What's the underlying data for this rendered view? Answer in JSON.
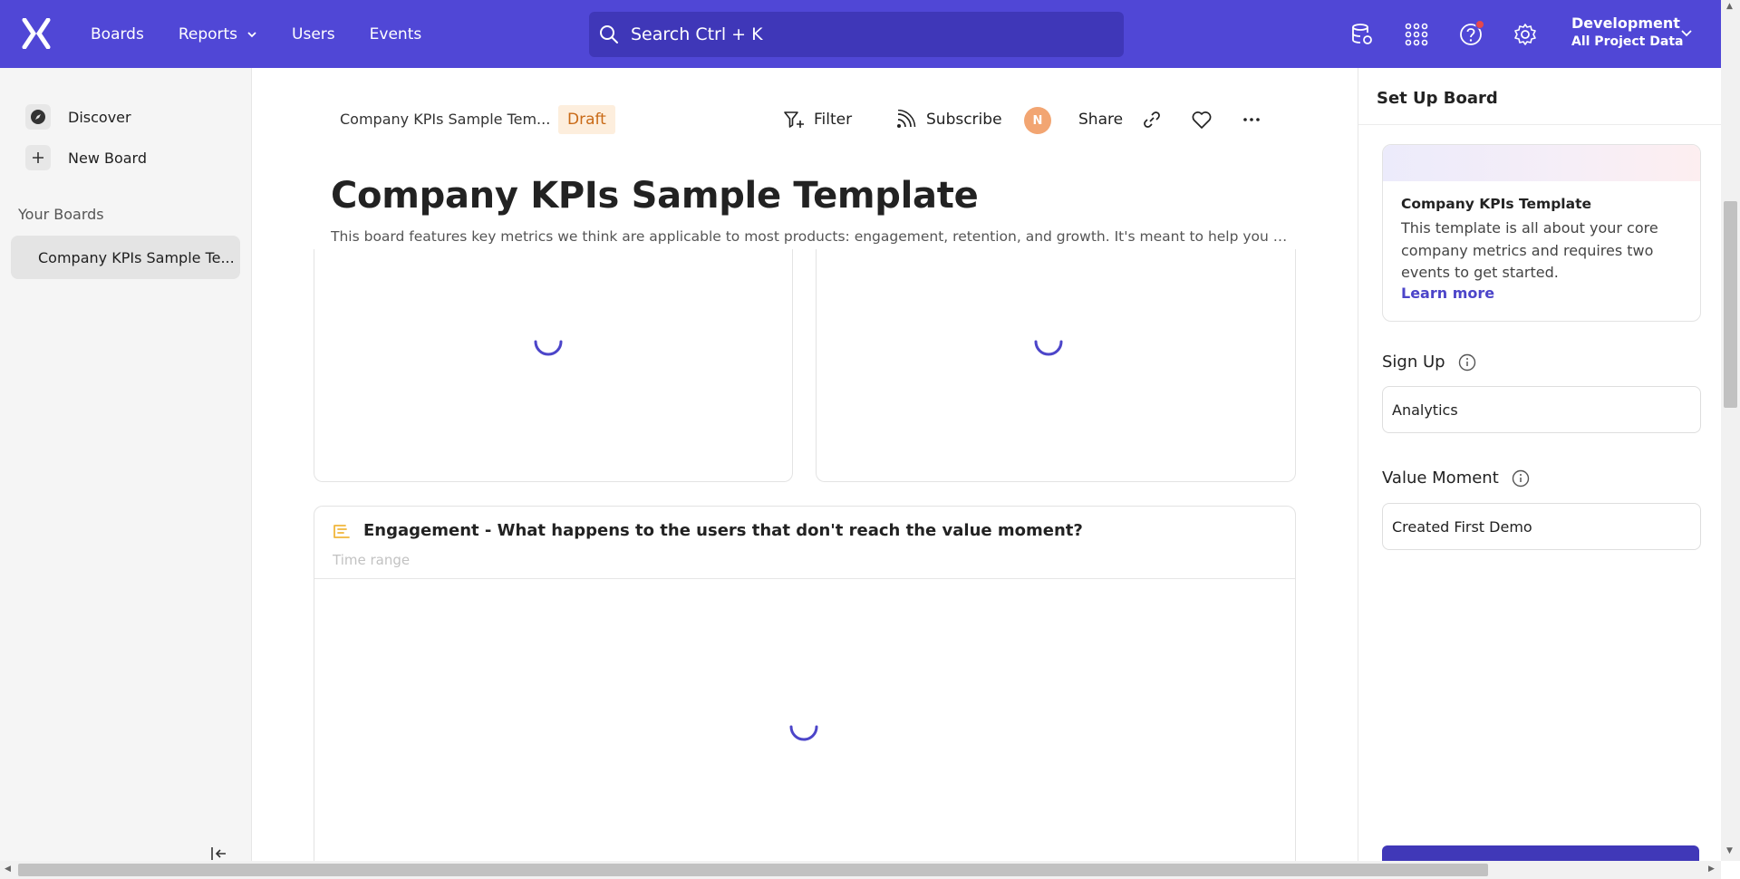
{
  "nav": {
    "links": [
      {
        "label": "Boards"
      },
      {
        "label": "Reports"
      },
      {
        "label": "Users"
      },
      {
        "label": "Events"
      }
    ],
    "search_placeholder": "Search  Ctrl + K",
    "project_name": "Development",
    "project_data": "All Project Data",
    "brand_color": "#5047d6"
  },
  "sidebar": {
    "discover_label": "Discover",
    "new_board_label": "New Board",
    "your_boards_label": "Your Boards",
    "boards": [
      {
        "label": "Company KPIs Sample Te..."
      }
    ]
  },
  "board": {
    "breadcrumb": "Company KPIs Sample Tem...",
    "status_badge": "Draft",
    "filter_label": "Filter",
    "subscribe_label": "Subscribe",
    "avatar_initial": "N",
    "share_label": "Share",
    "title": "Company KPIs Sample Template",
    "description": "This board features key metrics we think are applicable to most products: engagement, retention, and growth. It's meant to help you get up...",
    "cards": [
      {
        "title": "Engagement - What happens to the users that don't reach the value moment?",
        "subtitle": "Time range"
      }
    ]
  },
  "setup_panel": {
    "title": "Set Up Board",
    "template_name": "Company KPIs Template",
    "template_description": "This template is all about your core company metrics and requires two events to get started.",
    "learn_more": "Learn more",
    "fields": [
      {
        "label": "Sign Up",
        "value": "Analytics"
      },
      {
        "label": "Value Moment",
        "value": "Created First Demo"
      }
    ]
  }
}
